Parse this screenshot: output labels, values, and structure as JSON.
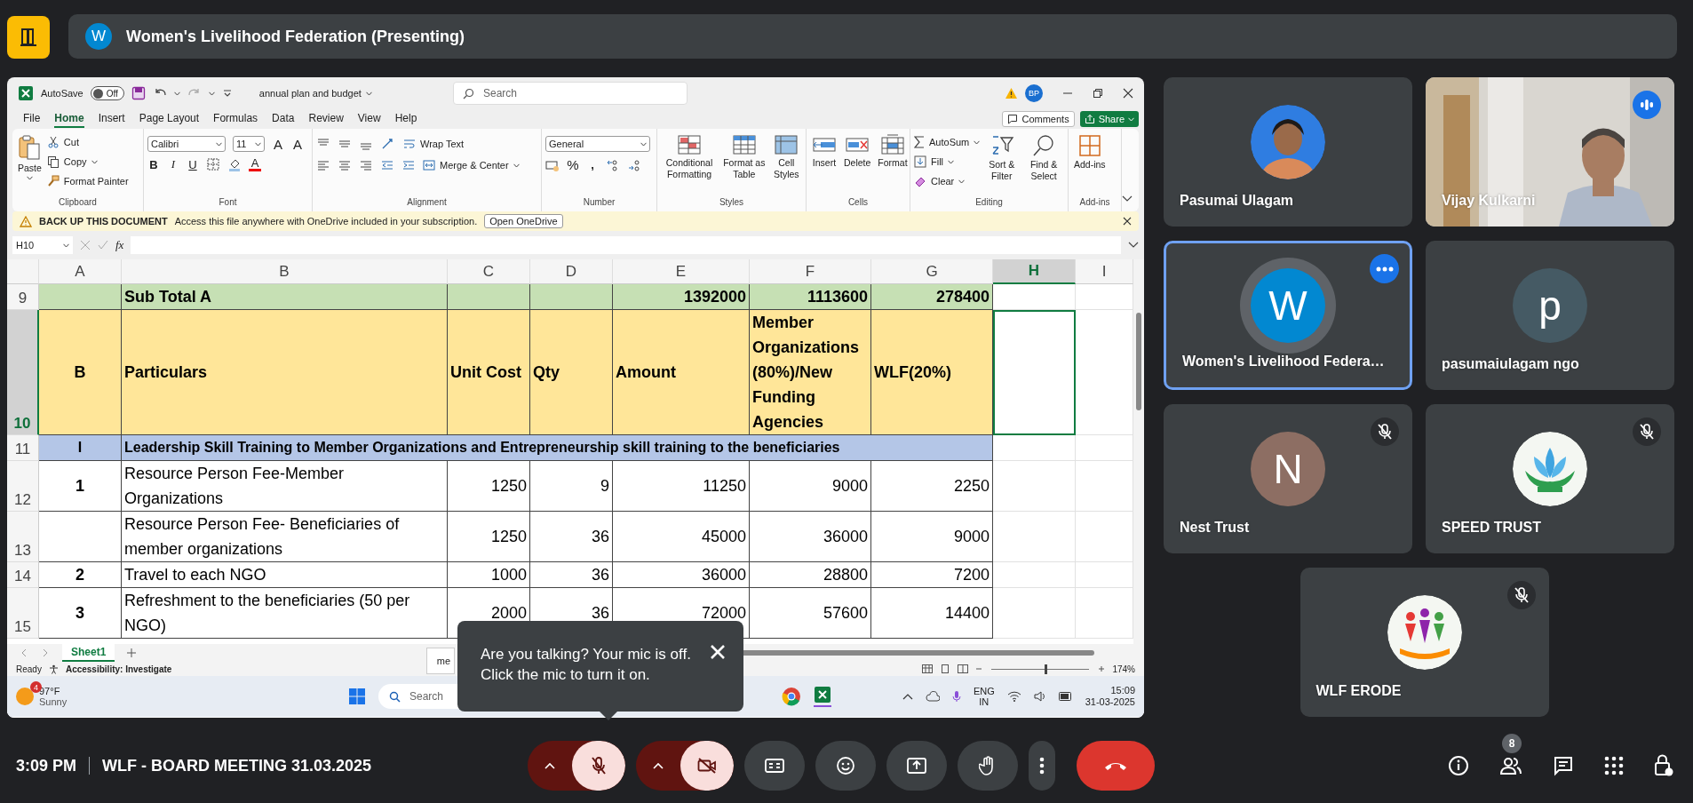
{
  "top_bar": {
    "presenter_initial": "W",
    "title": "Women's Livelihood Federation (Presenting)"
  },
  "excel": {
    "title_bar": {
      "autosave_label": "AutoSave",
      "autosave": {
        "on": false,
        "label": "Off"
      },
      "file_name": "annual plan and budget",
      "search_placeholder": "Search",
      "account_initials": "BP"
    },
    "menu_tabs": [
      {
        "label": "File",
        "selected": false
      },
      {
        "label": "Home",
        "selected": true
      },
      {
        "label": "Insert",
        "selected": false
      },
      {
        "label": "Page Layout",
        "selected": false
      },
      {
        "label": "Formulas",
        "selected": false
      },
      {
        "label": "Data",
        "selected": false
      },
      {
        "label": "Review",
        "selected": false
      },
      {
        "label": "View",
        "selected": false
      },
      {
        "label": "Help",
        "selected": false
      }
    ],
    "comments": "Comments",
    "share": "Share",
    "ribbon": {
      "clipboard": {
        "label": "Clipboard",
        "paste": "Paste",
        "cut": "Cut",
        "copy": "Copy",
        "format_painter": "Format Painter"
      },
      "font": {
        "label": "Font",
        "font_name": "Calibri",
        "font_size": "11",
        "grow_font": "A",
        "shrink_font": "A",
        "bold": "B",
        "italic": "I",
        "underline": "U",
        "font_color": "A"
      },
      "alignment": {
        "label": "Alignment",
        "wrap_text": "Wrap Text",
        "merge_center": "Merge & Center"
      },
      "number": {
        "label": "Number",
        "format": "General",
        "percent": "%",
        "comma": ","
      },
      "styles": {
        "label": "Styles",
        "conditional_formatting": "Conditional Formatting",
        "format_as_table": "Format as Table",
        "cell_styles": "Cell Styles"
      },
      "cells": {
        "label": "Cells",
        "insert": "Insert",
        "delete": "Delete",
        "format": "Format"
      },
      "editing": {
        "label": "Editing",
        "autosum": "AutoSum",
        "fill": "Fill",
        "clear": "Clear",
        "sort_filter": "Sort & Filter",
        "find_select": "Find & Select"
      },
      "addins": {
        "label": "Add-ins",
        "button": "Add-ins"
      }
    },
    "message_bar": {
      "title": "BACK UP THIS DOCUMENT",
      "text": "Access this file anywhere with OneDrive included in your subscription.",
      "button": "Open OneDrive"
    },
    "name_box": "H10",
    "formula_label": "fx",
    "columns": [
      {
        "letter": "A",
        "selected": false
      },
      {
        "letter": "B",
        "selected": false
      },
      {
        "letter": "C",
        "selected": false
      },
      {
        "letter": "D",
        "selected": false
      },
      {
        "letter": "E",
        "selected": false
      },
      {
        "letter": "F",
        "selected": false
      },
      {
        "letter": "G",
        "selected": false
      },
      {
        "letter": "H",
        "selected": true
      },
      {
        "letter": "I",
        "selected": false
      }
    ],
    "rows": [
      {
        "number": "9",
        "kind": "subtotal",
        "selected": false,
        "cells": {
          "b": "Sub Total A",
          "e": "1392000",
          "f": "1113600",
          "g": "278400"
        }
      },
      {
        "number": "10",
        "kind": "header",
        "selected": true,
        "cells": {
          "a": "B",
          "b": "Particulars",
          "c": "Unit Cost",
          "d": "Qty",
          "e": "Amount",
          "f": "Member Organizations (80%)/New Funding Agencies",
          "g": "WLF(20%)"
        }
      },
      {
        "number": "11",
        "kind": "section",
        "selected": false,
        "cells": {
          "a": "I",
          "b": "Leadership Skill Training to Member Organizations and Entrepreneurship skill training to the beneficiaries"
        }
      },
      {
        "number": "12",
        "kind": "item",
        "selected": false,
        "cells": {
          "a": "1",
          "b": "Resource Person Fee-Member Organizations",
          "c": "1250",
          "d": "9",
          "e": "11250",
          "f": "9000",
          "g": "2250"
        }
      },
      {
        "number": "13",
        "kind": "item",
        "selected": false,
        "cells": {
          "b": "Resource Person Fee- Beneficiaries of member organizations",
          "c": "1250",
          "d": "36",
          "e": "45000",
          "f": "36000",
          "g": "9000"
        }
      },
      {
        "number": "14",
        "kind": "item",
        "selected": false,
        "cells": {
          "a": "2",
          "b": "Travel to each NGO",
          "c": "1000",
          "d": "36",
          "e": "36000",
          "f": "28800",
          "g": "7200"
        }
      },
      {
        "number": "15",
        "kind": "item",
        "selected": false,
        "cells": {
          "a": "3",
          "b": "Refreshment to the beneficiaries (50 per NGO)",
          "c": "2000",
          "d": "36",
          "e": "72000",
          "f": "57600",
          "g": "14400"
        }
      }
    ],
    "sheet_tabs": [
      {
        "label": "Sheet1",
        "selected": true
      }
    ],
    "status": {
      "ready": "Ready",
      "accessibility": "Accessibility: Investigate",
      "zoom": {
        "label": "174%",
        "level": 0.55
      }
    },
    "popup_fragment": "me",
    "taskbar": {
      "weather_badge": "4",
      "temperature": "97°F",
      "weather": "Sunny",
      "search_placeholder": "Search",
      "language": "ENG",
      "region": "IN",
      "time": "15:09",
      "date": "31-03-2025"
    }
  },
  "mic_tooltip": "Are you talking? Your mic is off. Click the mic to turn it on.",
  "participants": [
    {
      "name": "Pasumai Ulagam",
      "muted": false,
      "speaking": false,
      "selected": false
    },
    {
      "name": "Vijay Kulkarni",
      "kind": "video",
      "muted": false,
      "speaking": true,
      "selected": false
    },
    {
      "name": "Women's Livelihood Federa…",
      "kind": "letter",
      "letter": "W",
      "color": "#0288d1",
      "muted": false,
      "speaking": false,
      "selected": true
    },
    {
      "name": "pasumaiulagam ngo",
      "kind": "letter",
      "letter": "p",
      "color": "#455a64",
      "muted": false,
      "speaking": false,
      "selected": false
    },
    {
      "name": "Nest Trust",
      "kind": "letter",
      "letter": "N",
      "color": "#8d6e63",
      "muted": true,
      "speaking": false,
      "selected": false
    },
    {
      "name": "SPEED TRUST",
      "kind": "logo",
      "muted": true,
      "speaking": false,
      "selected": false
    },
    {
      "name": "WLF ERODE",
      "kind": "logo",
      "muted": true,
      "speaking": false,
      "selected": false
    }
  ],
  "bottom_bar": {
    "time": "3:09 PM",
    "meeting_title": "WLF - BOARD MEETING 31.03.2025",
    "mic_on": false,
    "camera_on": false,
    "people_count": "8"
  }
}
